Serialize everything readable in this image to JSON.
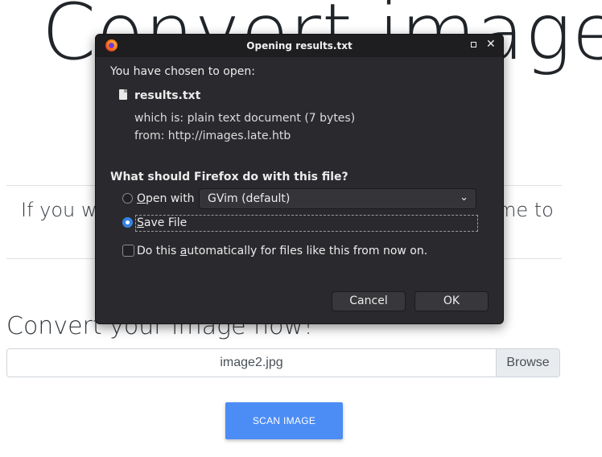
{
  "background": {
    "title": "Convert image",
    "lead_left": "If you wa",
    "lead_right": "me to",
    "convert_heading": "Convert your image now!",
    "file_name": "image2.jpg",
    "browse_label": "Browse",
    "scan_label": "SCAN IMAGE"
  },
  "dialog": {
    "title": "Opening results.txt",
    "chosen_text": "You have chosen to open:",
    "file_name": "results.txt",
    "which_is_label": "which is:",
    "which_is_value": "plain text document (7 bytes)",
    "from_label": "from:",
    "from_value": "http://images.late.htb",
    "question": "What should Firefox do with this file?",
    "open_with_prefix": "O",
    "open_with_rest": "pen with",
    "open_with_app": "GVim (default)",
    "save_file_prefix": "S",
    "save_file_rest": "ave File",
    "selected_option": "save_file",
    "auto_prefix": "Do this ",
    "auto_underlined": "a",
    "auto_rest": "utomatically for files like this from now on.",
    "auto_checked": false,
    "cancel_label": "Cancel",
    "ok_label": "OK"
  },
  "icons": {
    "app": "firefox-icon",
    "maximize": "maximize-icon",
    "close": "close-icon",
    "document": "document-icon",
    "dropdown": "chevron-down-icon"
  },
  "colors": {
    "dialog_bg": "#2a2a2e",
    "accent": "#3584e4",
    "scan_button": "#4c8cf5"
  }
}
